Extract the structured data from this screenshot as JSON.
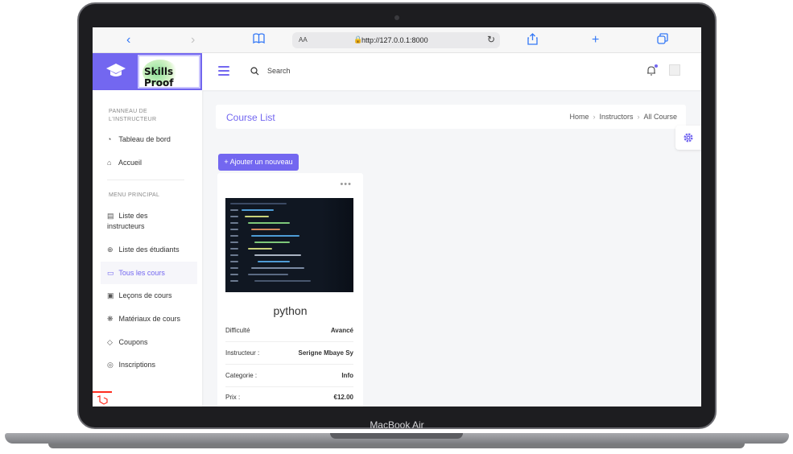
{
  "device": {
    "label": "MacBook Air"
  },
  "browser": {
    "text_size": "AA",
    "url": "http://127.0.0.1:8000"
  },
  "brand": {
    "logo_text": "Skills Proof"
  },
  "header": {
    "search_label": "Search"
  },
  "sidebar": {
    "section1_title": "PANNEAU DE L'INSTRUCTEUR",
    "section2_title": "MENU PRINCIPAL",
    "items": [
      {
        "label": "Tableau de bord",
        "icon": "dashboard-icon"
      },
      {
        "label": "Accueil",
        "icon": "home-icon"
      },
      {
        "label": "Liste des instructeurs",
        "icon": "list-icon"
      },
      {
        "label": "Liste des étudiants",
        "icon": "students-icon"
      },
      {
        "label": "Tous les cours",
        "icon": "book-icon"
      },
      {
        "label": "Leçons de cours",
        "icon": "lessons-icon"
      },
      {
        "label": "Matériaux de cours",
        "icon": "materials-icon"
      },
      {
        "label": "Coupons",
        "icon": "tag-icon"
      },
      {
        "label": "Inscriptions",
        "icon": "enroll-icon"
      }
    ],
    "active_item": "Tous les cours"
  },
  "page": {
    "title": "Course List",
    "breadcrumb": [
      "Home",
      "Instructors",
      "All Course"
    ],
    "add_button": "+ Ajouter un nouveau"
  },
  "course": {
    "title": "python",
    "rows": [
      {
        "label": "Difficulté",
        "value": "Avancé"
      },
      {
        "label": "Instructeur :",
        "value": "Serigne Mbaye Sy"
      },
      {
        "label": "Categorie :",
        "value": "Info"
      },
      {
        "label": "Prix :",
        "value": "€12.00"
      }
    ]
  },
  "colors": {
    "accent": "#7367f0",
    "background": "#f5f6f8"
  }
}
